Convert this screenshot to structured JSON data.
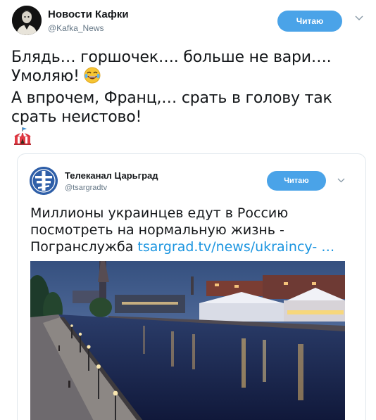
{
  "author": {
    "name": "Новости Кафки",
    "handle": "@Kafka_News",
    "follow_label": "Читаю",
    "avatar_icon": "portrait-avatar-icon"
  },
  "tweet": {
    "line1": "Блядь… горшочек…. больше не вари….",
    "line2": "Умоляю!",
    "line3": "А впрочем, Франц,… срать в голову так",
    "line4": "срать неистово!",
    "emoji_1": "face-with-tears-of-joy-icon",
    "emoji_2": "circus-tent-icon"
  },
  "quoted": {
    "name": "Телеканал Царьград",
    "handle": "@tsargradtv",
    "follow_label": "Читаю",
    "avatar_icon": "tsargrad-cross-logo-icon",
    "line1": "Миллионы украинцев едут в Россию",
    "line2": "посмотреть на нормальную жизнь -",
    "line3_text": "Погранслужба",
    "line3_link": "tsargrad.tv/news/ukraincy-",
    "line3_ellipsis": "…",
    "photo": "city-embankment-at-dusk-photo"
  },
  "colors": {
    "accent": "#1b95e0",
    "button": "#4aa3e8",
    "muted": "#657786",
    "text": "#14171a",
    "border": "#e1e8ed"
  }
}
